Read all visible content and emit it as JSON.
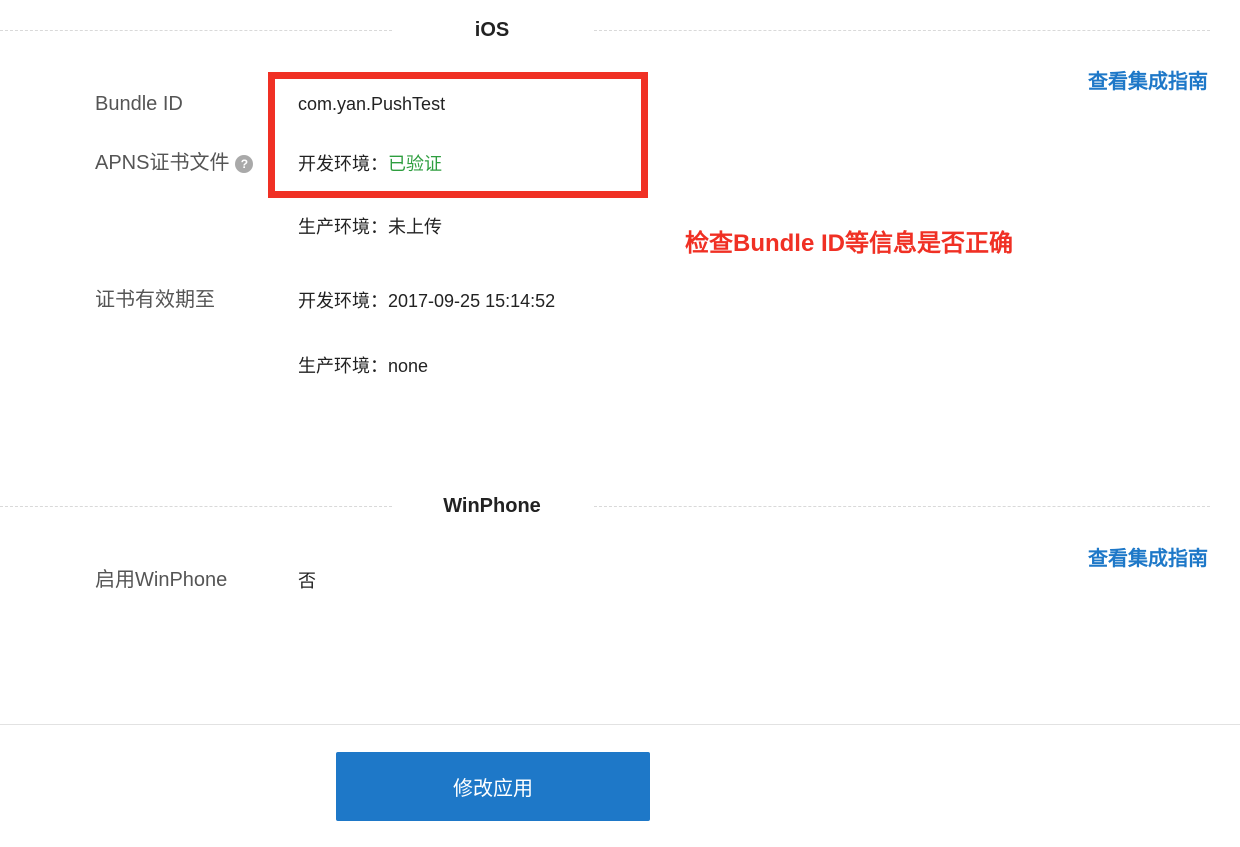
{
  "ios": {
    "title": "iOS",
    "guide_link": "查看集成指南",
    "bundle_id_label": "Bundle ID",
    "bundle_id_value": "com.yan.PushTest",
    "apns_label": "APNS证书文件",
    "help_icon": "?",
    "apns_dev_prefix": "开发环境：",
    "apns_dev_status": "已验证",
    "apns_prod": "生产环境：未上传",
    "expiry_label": "证书有效期至",
    "expiry_dev": "开发环境：2017-09-25 15:14:52",
    "expiry_prod": "生产环境：none"
  },
  "annotation": {
    "text": "检查Bundle ID等信息是否正确",
    "color": "#f03024"
  },
  "winphone": {
    "title": "WinPhone",
    "guide_link": "查看集成指南",
    "enable_label": "启用WinPhone",
    "enable_value": "否"
  },
  "footer": {
    "submit_label": "修改应用"
  },
  "colors": {
    "accent": "#1e78c8",
    "verified": "#2e9e3f",
    "annotation": "#f03024"
  }
}
